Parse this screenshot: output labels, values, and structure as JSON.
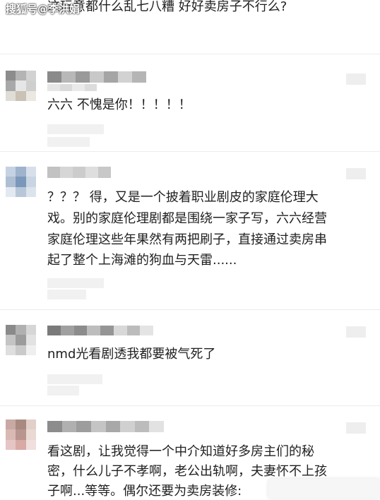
{
  "watermark": "搜狐号@李洪娟",
  "top_comment": "这玩意都什么乱七八糟 好好卖房子不行么?",
  "comments": [
    {
      "lines": [
        "六六 不愧是你！！！！！"
      ]
    },
    {
      "lines": [
        "？？？ 得，又是一个披着职业剧皮的家庭伦理大",
        "戏。别的家庭伦理剧都是围绕一家子写，六六经营",
        "家庭伦理这些年果然有两把刷子，直接通过卖房串",
        "起了整个上海滩的狗血与天雷......"
      ]
    },
    {
      "lines": [
        "nmd光看剧透我都要被气死了"
      ]
    },
    {
      "lines": [
        "看这剧，让我觉得一个中介知道好多房主们的秘",
        "密，什么儿子不孝啊，老公出轨啊，夫妻怀不上孩",
        "子啊...等等。偶尔还要为卖房装修:"
      ]
    }
  ],
  "colors": {
    "avatar1": [
      "#8c8c8c",
      "#b4b4b4",
      "#d2d2d2",
      "#a8a8a8",
      "#e6e6e6",
      "#cfcfcf",
      "#e0ddd6",
      "#c9c2b5",
      "#ebe8e2"
    ],
    "avatar2": [
      "#c5d2e2",
      "#9fb3cc",
      "#d7e0ea",
      "#aebfd3",
      "#7b98bb",
      "#c9d5e3",
      "#e3e9f0",
      "#b8c7d8",
      "#dbe3ec"
    ],
    "avatar3": [
      "#8a8a8a",
      "#b0b0b0",
      "#d6d6d6",
      "#c4c4c4",
      "#9c9c9c",
      "#e2e2e2",
      "#dedede",
      "#cacaca",
      "#efefef"
    ],
    "avatar4": [
      "#c9a9a4",
      "#a98a80",
      "#e2cfc9",
      "#d8b9b3",
      "#b99590",
      "#ead8d3",
      "#e6c6c4",
      "#d7aaa6",
      "#f0dfdc"
    ]
  }
}
